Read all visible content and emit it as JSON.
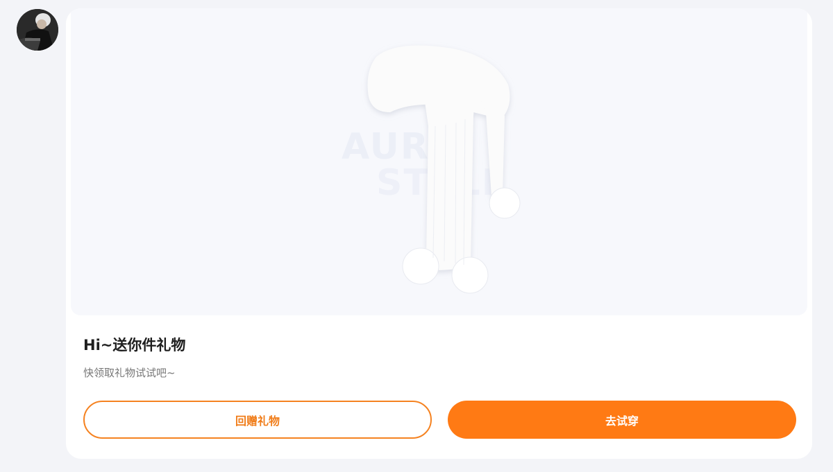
{
  "avatar": {
    "icon": "user-avatar"
  },
  "gift": {
    "image_icon": "white-scarf-image",
    "watermark_line1": "AUR",
    "watermark_line2": "STYLE",
    "title": "Hi~送你件礼物",
    "subtitle": "快领取礼物试试吧~"
  },
  "actions": {
    "return_gift_label": "回赠礼物",
    "try_on_label": "去试穿"
  },
  "colors": {
    "accent": "#ff7a14",
    "outline": "#f58220",
    "background": "#f3f4f8",
    "card": "#ffffff"
  }
}
